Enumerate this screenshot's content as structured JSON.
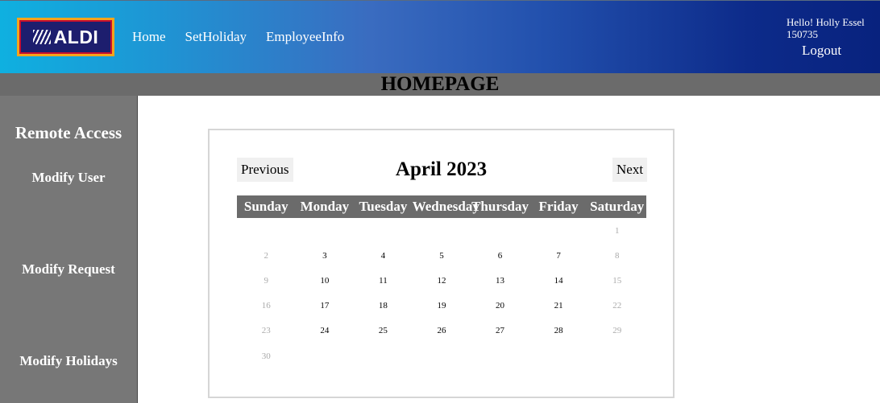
{
  "header": {
    "logo_text": "ALDI",
    "nav": [
      "Home",
      "SetHoliday",
      "EmployeeInfo"
    ],
    "greeting": "Hello! Holly Essel",
    "employee_id": "150735",
    "logout_label": "Logout"
  },
  "page_title": "HOMEPAGE",
  "sidebar": {
    "heading": "Remote Access",
    "items": [
      "Modify User",
      "Modify Request",
      "Modify Holidays"
    ]
  },
  "calendar": {
    "month_title": "April 2023",
    "prev_label": "Previous",
    "next_label": "Next",
    "weekdays": [
      "Sunday",
      "Monday",
      "Tuesday",
      "Wednesday",
      "Thursday",
      "Friday",
      "Saturday"
    ],
    "weeks": [
      [
        "",
        "",
        "",
        "",
        "",
        "",
        "1"
      ],
      [
        "2",
        "3",
        "4",
        "5",
        "6",
        "7",
        "8"
      ],
      [
        "9",
        "10",
        "11",
        "12",
        "13",
        "14",
        "15"
      ],
      [
        "16",
        "17",
        "18",
        "19",
        "20",
        "21",
        "22"
      ],
      [
        "23",
        "24",
        "25",
        "26",
        "27",
        "28",
        "29"
      ],
      [
        "30",
        "",
        "",
        "",
        "",
        "",
        ""
      ]
    ]
  },
  "colors": {
    "header_gradient_start": "#0fb0e0",
    "header_gradient_end": "#08227e",
    "title_bar": "#6b6b6b",
    "sidebar": "#777777",
    "weekend_text": "#aaaaaa"
  }
}
